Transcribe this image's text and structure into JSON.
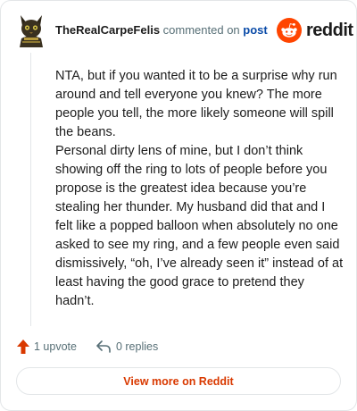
{
  "header": {
    "username": "TheRealCarpeFelis",
    "action_text": "commented on",
    "post_link": "post"
  },
  "brand": {
    "logo_text": "reddit",
    "color": "#ff4500"
  },
  "comment": {
    "paragraphs": [
      "NTA, but if you wanted it to be a surprise why run around and tell everyone you knew? The more people you tell, the more likely someone will spill the beans.",
      "Personal dirty lens of mine, but I don’t think showing off the ring to lots of people before you propose is the greatest idea because you’re stealing her thunder. My husband did that and I felt like a popped balloon when absolutely no one asked to see my ring, and a few people even said dismissively, “oh, I’ve already seen it” instead of at least having the good grace to pretend they hadn’t."
    ]
  },
  "actions": {
    "upvotes": "1 upvote",
    "replies": "0 replies"
  },
  "footer": {
    "view_more_label": "View more on Reddit"
  },
  "icons": {
    "avatar": "cat-avatar-icon",
    "logo": "reddit-snoo-icon",
    "upvote": "upvote-arrow-icon",
    "reply": "reply-arrow-icon"
  },
  "colors": {
    "upvote": "#d93900",
    "link": "#0a4ba8",
    "text": "#1c1c1c",
    "muted": "#576f76"
  }
}
